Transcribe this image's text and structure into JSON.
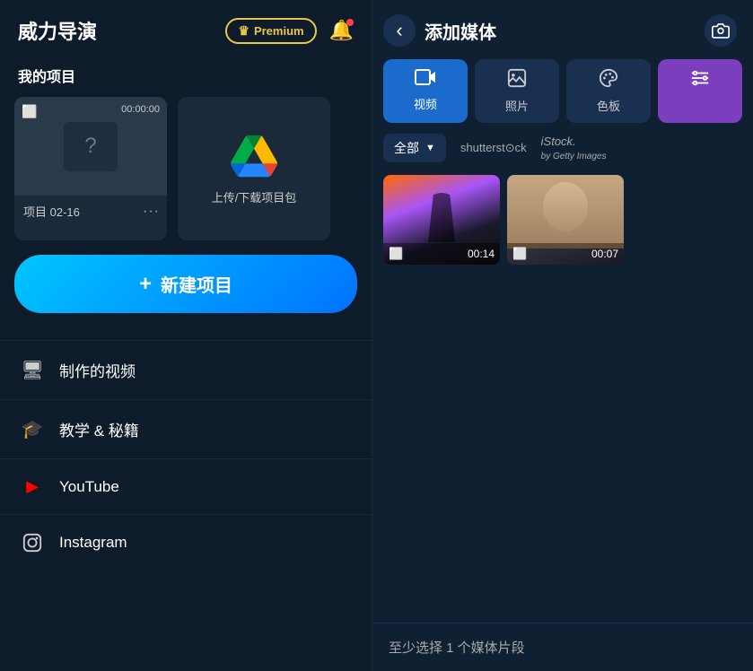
{
  "app": {
    "title": "威力导演",
    "premium_label": "Premium",
    "crown": "♛"
  },
  "header": {
    "bell_icon": "🔔",
    "camera_icon": "📷"
  },
  "left": {
    "my_projects_label": "我的项目",
    "project1": {
      "name": "项目 02-16",
      "duration": "00:00:00"
    },
    "upload_card_label": "上传/下载项目包",
    "new_project_label": "新建项目",
    "menu": [
      {
        "icon": "🖥",
        "label": "制作的视频"
      },
      {
        "icon": "🎓",
        "label": "教学 & 秘籍"
      },
      {
        "icon": "▶",
        "label": "YouTube"
      },
      {
        "icon": "📷",
        "label": "Instagram"
      }
    ]
  },
  "right": {
    "title": "添加媒体",
    "tabs": [
      {
        "id": "video",
        "icon": "📹",
        "label": "视频",
        "active": true
      },
      {
        "id": "photo",
        "icon": "🖼",
        "label": "照片",
        "active": false
      },
      {
        "id": "palette",
        "icon": "🎨",
        "label": "色板",
        "active": false
      },
      {
        "id": "filter",
        "icon": "⚙",
        "label": "",
        "active": false,
        "purple": true
      }
    ],
    "filter_all": "全部",
    "source_shutterstock": "shutterst⊙ck",
    "source_istock": "iStock.",
    "source_istock_sub": "by Getty Images",
    "media_items": [
      {
        "duration": "00:14",
        "gradient": "1"
      },
      {
        "duration": "00:07",
        "gradient": "2"
      }
    ],
    "status": "至少选择 1 个媒体片段"
  }
}
